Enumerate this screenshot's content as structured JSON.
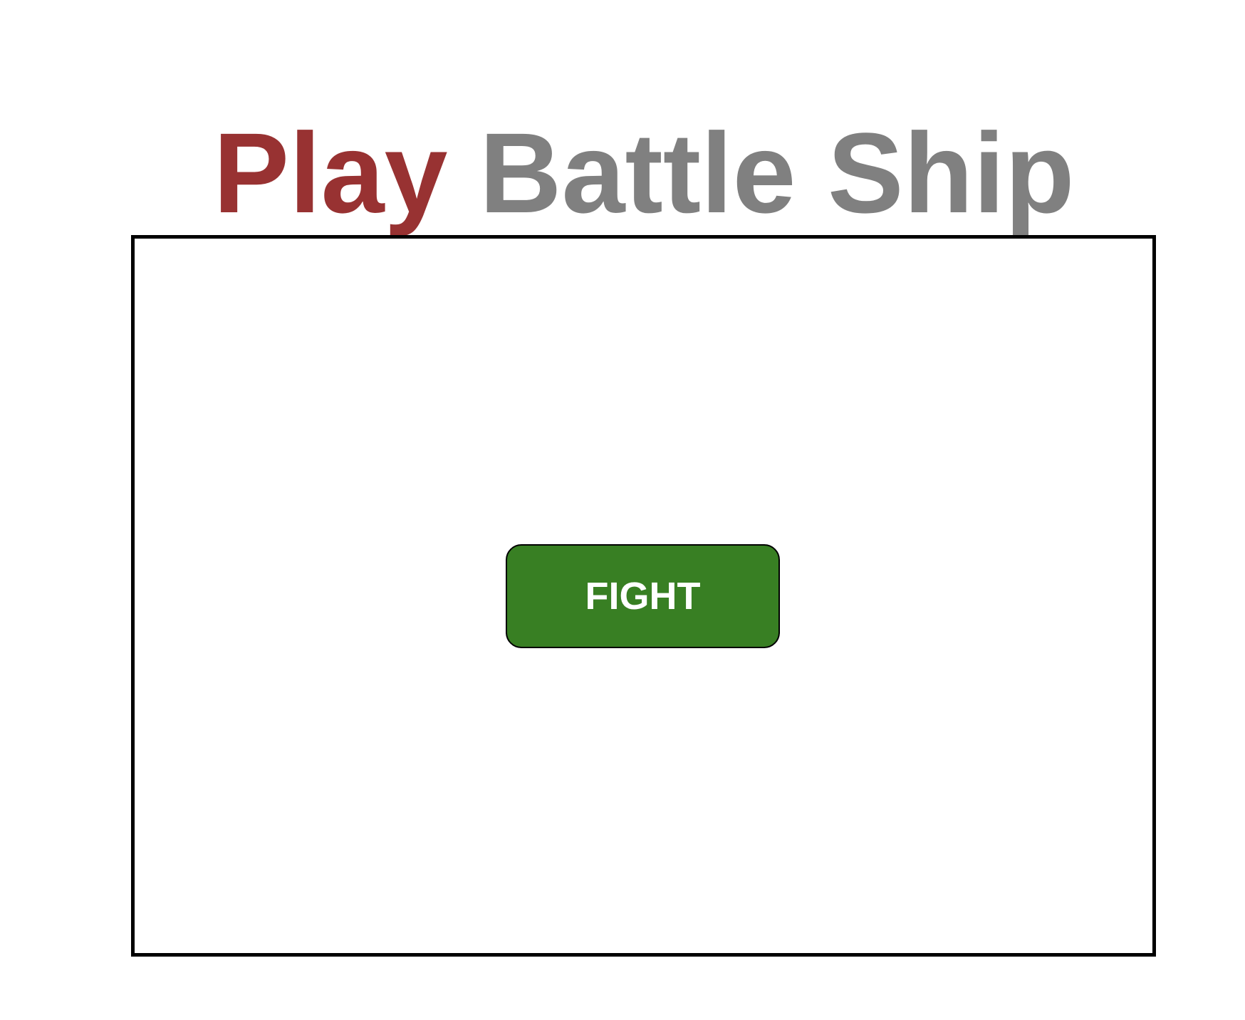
{
  "header": {
    "title_part1": "Play",
    "title_part2": "Battle Ship"
  },
  "board": {
    "fight_button_label": "FIGHT"
  },
  "colors": {
    "title_accent": "#983232",
    "title_gray": "#808080",
    "button_green": "#387f23",
    "button_text": "#ffffff",
    "board_border": "#000000"
  }
}
